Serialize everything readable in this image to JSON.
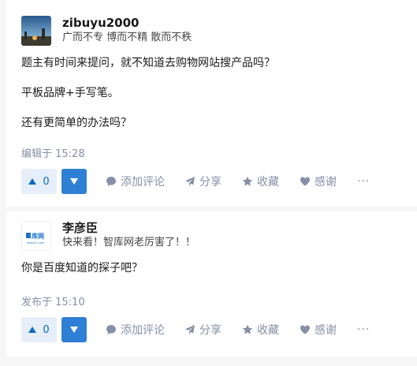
{
  "answers": [
    {
      "author_name": "zibuyu2000",
      "author_bio": "广而不专 博而不精 散而不秩",
      "content": [
        "题主有时间来提问，就不知道去购物网站搜产品吗？",
        "平板品牌+手写笔。",
        "还有更简单的办法吗？"
      ],
      "time": "编辑于 15:28",
      "vote_count": "0",
      "actions": {
        "comment": "添加评论",
        "share": "分享",
        "favorite": "收藏",
        "thanks": "感谢",
        "more": "···"
      }
    },
    {
      "author_name": "李彦臣",
      "author_bio": "快来看！智库网老厉害了！！",
      "avatar_logo_text": "库网",
      "avatar_logo_sub": "zhiku51.com",
      "content": [
        "你是百度知道的探子吧？"
      ],
      "time": "发布于 15:10",
      "vote_count": "0",
      "actions": {
        "comment": "添加评论",
        "share": "分享",
        "favorite": "收藏",
        "thanks": "感谢",
        "more": "···"
      }
    }
  ],
  "colors": {
    "accent": "#0e6ac8",
    "vote_bg": "#e6eff9",
    "vote_down_bg": "#2f7fd4",
    "meta": "#8590a6"
  }
}
